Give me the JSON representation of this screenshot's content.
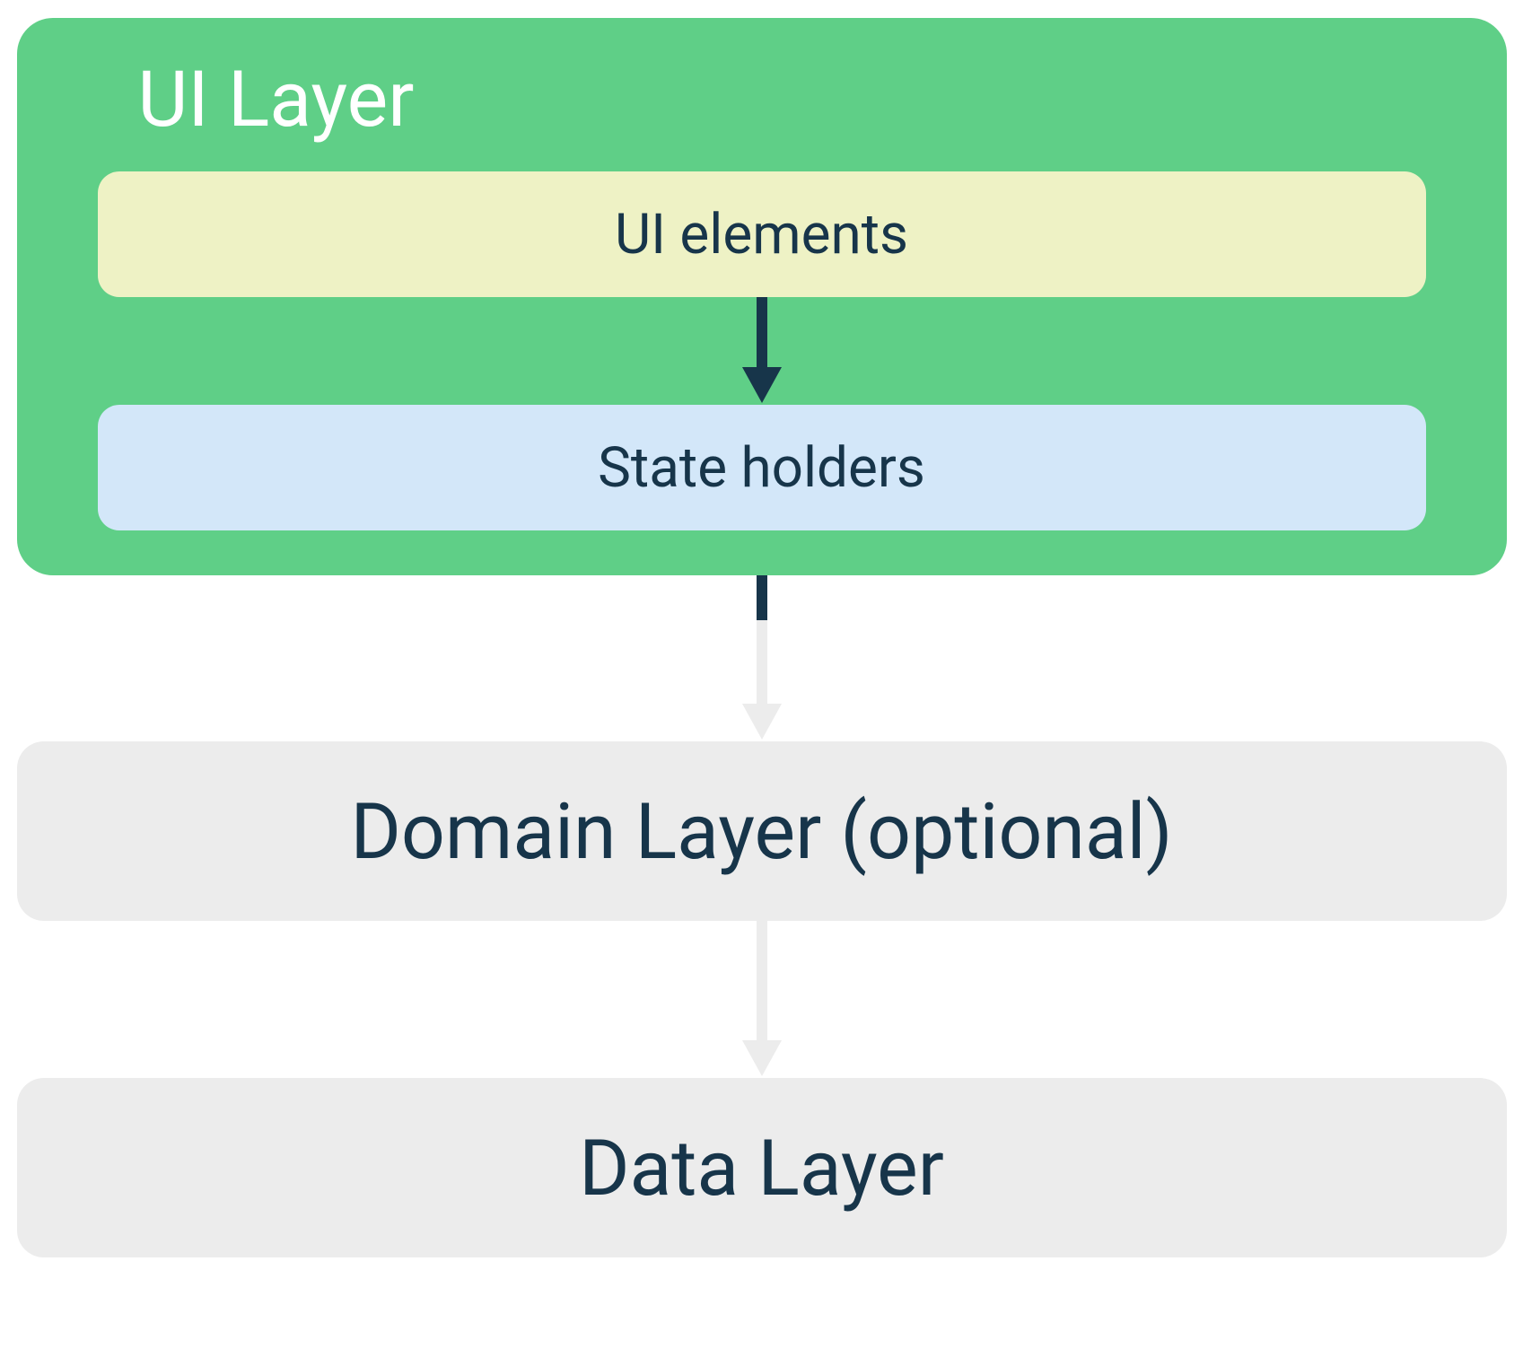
{
  "layers": {
    "ui_layer": {
      "title": "UI Layer",
      "ui_elements": "UI elements",
      "state_holders": "State holders"
    },
    "domain_layer": "Domain Layer (optional)",
    "data_layer": "Data Layer"
  },
  "colors": {
    "ui_layer_bg": "#5fcf87",
    "ui_elements_bg": "#eef2c5",
    "state_holders_bg": "#d3e7f9",
    "layer_box_bg": "#ececec",
    "text_dark": "#17354a",
    "arrow_dark": "#17354a",
    "arrow_light": "#ececec"
  }
}
